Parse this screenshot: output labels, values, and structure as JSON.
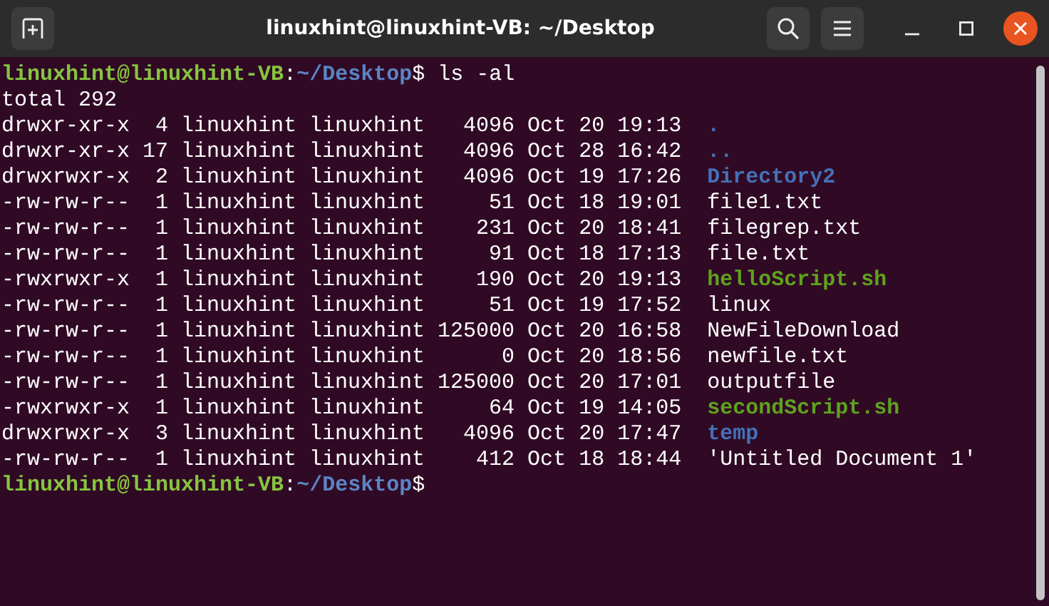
{
  "window": {
    "title": "linuxhint@linuxhint-VB: ~/Desktop"
  },
  "terminal": {
    "lines": [
      {
        "kind": "prompt",
        "user_host": "linuxhint@linuxhint-VB",
        "separator": ":",
        "path": "~/Desktop",
        "symbol": "$",
        "command": "ls -al"
      },
      {
        "kind": "text",
        "text": "total 292"
      },
      {
        "kind": "directory",
        "info": "drwxr-xr-x  4 linuxhint linuxhint   4096 Oct 20 19:13",
        "name": "."
      },
      {
        "kind": "directory",
        "info": "drwxr-xr-x 17 linuxhint linuxhint   4096 Oct 28 16:42",
        "name": ".."
      },
      {
        "kind": "directory",
        "info": "drwxrwxr-x  2 linuxhint linuxhint   4096 Oct 19 17:26",
        "name": "Directory2"
      },
      {
        "kind": "file",
        "info": "-rw-rw-r--  1 linuxhint linuxhint     51 Oct 18 19:01",
        "name": "file1.txt"
      },
      {
        "kind": "file",
        "info": "-rw-rw-r--  1 linuxhint linuxhint    231 Oct 20 18:41",
        "name": "filegrep.txt"
      },
      {
        "kind": "file",
        "info": "-rw-rw-r--  1 linuxhint linuxhint     91 Oct 18 17:13",
        "name": "file.txt"
      },
      {
        "kind": "executable",
        "info": "-rwxrwxr-x  1 linuxhint linuxhint    190 Oct 20 19:13",
        "name": "helloScript.sh"
      },
      {
        "kind": "file",
        "info": "-rw-rw-r--  1 linuxhint linuxhint     51 Oct 19 17:52",
        "name": "linux"
      },
      {
        "kind": "file",
        "info": "-rw-rw-r--  1 linuxhint linuxhint 125000 Oct 20 16:58",
        "name": "NewFileDownload"
      },
      {
        "kind": "file",
        "info": "-rw-rw-r--  1 linuxhint linuxhint      0 Oct 20 18:56",
        "name": "newfile.txt"
      },
      {
        "kind": "file",
        "info": "-rw-rw-r--  1 linuxhint linuxhint 125000 Oct 20 17:01",
        "name": "outputfile"
      },
      {
        "kind": "executable",
        "info": "-rwxrwxr-x  1 linuxhint linuxhint     64 Oct 19 14:05",
        "name": "secondScript.sh"
      },
      {
        "kind": "directory",
        "info": "drwxrwxr-x  3 linuxhint linuxhint   4096 Oct 20 17:47",
        "name": "temp"
      },
      {
        "kind": "file",
        "info": "-rw-rw-r--  1 linuxhint linuxhint    412 Oct 18 18:44",
        "name": "'Untitled Document 1'"
      },
      {
        "kind": "prompt",
        "user_host": "linuxhint@linuxhint-VB",
        "separator": ":",
        "path": "~/Desktop",
        "symbol": "$"
      }
    ]
  }
}
